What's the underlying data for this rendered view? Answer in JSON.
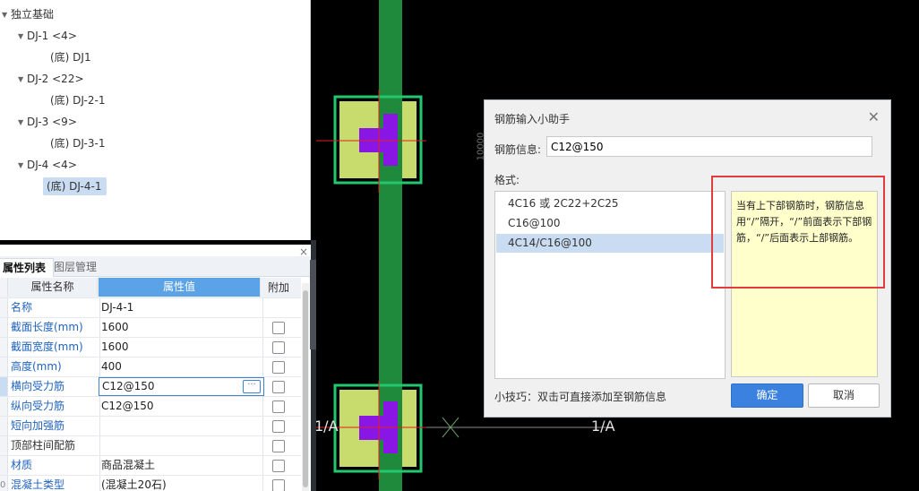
{
  "tree": {
    "items": [
      {
        "label": "独立基础"
      },
      {
        "label": "DJ-1 <4>"
      },
      {
        "label": "(底) DJ1"
      },
      {
        "label": "DJ-2 <22>"
      },
      {
        "label": "(底) DJ-2-1"
      },
      {
        "label": "DJ-3 <9>"
      },
      {
        "label": "(底) DJ-3-1"
      },
      {
        "label": "DJ-4 <4>"
      },
      {
        "label": "(底) DJ-4-1"
      }
    ]
  },
  "props": {
    "close": "×",
    "tabs": [
      "属性列表",
      "图层管理"
    ],
    "header": {
      "name": "属性名称",
      "value": "属性值",
      "extra": "附加"
    },
    "rows": [
      {
        "idx": "",
        "name": "名称",
        "value": "DJ-4-1"
      },
      {
        "idx": "",
        "name": "截面长度(mm)",
        "value": "1600"
      },
      {
        "idx": "",
        "name": "截面宽度(mm)",
        "value": "1600"
      },
      {
        "idx": "",
        "name": "高度(mm)",
        "value": "400"
      },
      {
        "idx": "",
        "name": "横向受力筋",
        "value": "C12@150"
      },
      {
        "idx": "",
        "name": "纵向受力筋",
        "value": "C12@150"
      },
      {
        "idx": "",
        "name": "短向加强筋",
        "value": ""
      },
      {
        "idx": "",
        "name": "顶部柱间配筋",
        "value": ""
      },
      {
        "idx": "",
        "name": "材质",
        "value": "商品混凝土"
      },
      {
        "idx": "0",
        "name": "混凝土类型",
        "value": "(混凝土20石)"
      }
    ],
    "edit_button": "···"
  },
  "canvas": {
    "axis_labels": [
      "1/A",
      "1/A"
    ],
    "side_label": "10000"
  },
  "dialog": {
    "title": "钢筋输入小助手",
    "close": "✕",
    "info_label": "钢筋信息:",
    "info_value": "C12@150",
    "format_label": "格式:",
    "formats": [
      "4C16 或 2C22+2C25",
      "C16@100",
      "4C14/C16@100"
    ],
    "hint": "当有上下部钢筋时，钢筋信息用“/”隔开，“/”前面表示下部钢筋，“/”后面表示上部钢筋。",
    "tip": "小技巧：双击可直接添加至钢筋信息",
    "ok": "确定",
    "cancel": "取消"
  },
  "colors": {
    "accent": "#3b82e0",
    "selection": "#c9dcf2",
    "column_strip": "#1f8a3c",
    "footing_fill": "#c8dc6e",
    "footing_border": "#22c86e",
    "rebar_purple": "#8a16e6",
    "highlight_red": "#e03c3c"
  }
}
